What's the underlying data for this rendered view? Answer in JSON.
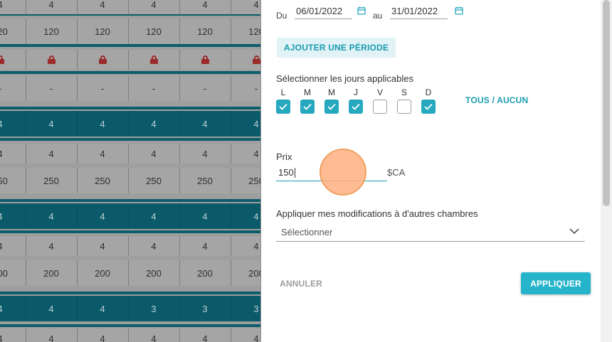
{
  "grid": {
    "rows": [
      {
        "kind": "light",
        "values": [
          "4",
          "4",
          "4",
          "4",
          "4",
          "4"
        ]
      },
      {
        "kind": "light",
        "values": [
          "120",
          "120",
          "120",
          "120",
          "120",
          "120"
        ]
      },
      {
        "kind": "lock"
      },
      {
        "kind": "light",
        "values": [
          "-",
          "-",
          "-",
          "-",
          "-",
          "-"
        ]
      },
      {
        "kind": "dark",
        "values": [
          "4",
          "4",
          "4",
          "4",
          "4",
          "4"
        ]
      },
      {
        "kind": "light",
        "values": [
          "4",
          "4",
          "4",
          "4",
          "4",
          "4"
        ]
      },
      {
        "kind": "light",
        "values": [
          "250",
          "250",
          "250",
          "250",
          "250",
          "250"
        ]
      },
      {
        "kind": "dark",
        "values": [
          "4",
          "4",
          "4",
          "4",
          "4",
          "4"
        ]
      },
      {
        "kind": "light",
        "values": [
          "4",
          "4",
          "4",
          "4",
          "4",
          "4"
        ]
      },
      {
        "kind": "light",
        "values": [
          "200",
          "200",
          "200",
          "200",
          "200",
          "200"
        ]
      },
      {
        "kind": "dark",
        "values": [
          "4",
          "4",
          "4",
          "3",
          "3",
          "3"
        ]
      },
      {
        "kind": "light",
        "values": [
          "4",
          "4",
          "4",
          "4",
          "4",
          "4"
        ]
      }
    ]
  },
  "period": {
    "from_label": "Du",
    "from_value": "06/01/2022",
    "to_label": "au",
    "to_value": "31/01/2022",
    "add_period_label": "AJOUTER UNE PÉRIODE"
  },
  "days": {
    "label": "Sélectionner les jours applicables",
    "items": [
      {
        "letter": "L",
        "checked": true
      },
      {
        "letter": "M",
        "checked": true
      },
      {
        "letter": "M",
        "checked": true
      },
      {
        "letter": "J",
        "checked": true
      },
      {
        "letter": "V",
        "checked": false
      },
      {
        "letter": "S",
        "checked": false
      },
      {
        "letter": "D",
        "checked": true
      }
    ],
    "toggle_all_label": "TOUS / AUCUN"
  },
  "price": {
    "label": "Prix",
    "value": "150",
    "currency": "$CA"
  },
  "apply_other_rooms": {
    "label": "Appliquer mes modifications à d'autres chambres",
    "placeholder": "Sélectionner"
  },
  "actions": {
    "cancel_label": "ANNULER",
    "apply_label": "APPLIQUER"
  },
  "colors": {
    "accent": "#26b4ca",
    "accent_text": "#1a9bb0",
    "dark_row": "#0a5a69",
    "lock": "#9b2a2a",
    "touch_indicator": "#ffb080"
  }
}
